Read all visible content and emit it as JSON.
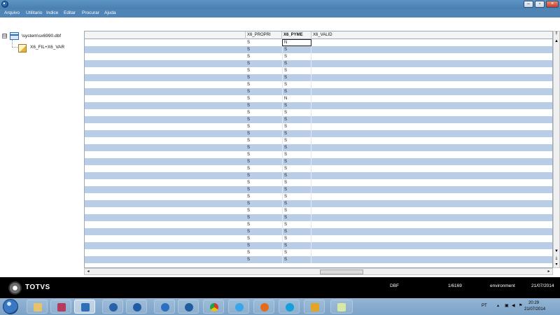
{
  "menu": {
    "items": [
      "Arquivo",
      "Utilitario",
      "Indice",
      "Editar",
      "Procurar",
      "Ajuda"
    ]
  },
  "tree": {
    "root_label": "\\system\\sx6990.dbf",
    "child_label": "X6_FIL+X6_VAR",
    "expander": "⊟"
  },
  "grid": {
    "headers": [
      "",
      "X6_PROPRI",
      "X6_PYME",
      "X6_VALID"
    ],
    "rows": [
      [
        "S",
        "N"
      ],
      [
        "S",
        "S"
      ],
      [
        "S",
        "S"
      ],
      [
        "S",
        "S"
      ],
      [
        "S",
        "S"
      ],
      [
        "S",
        "S"
      ],
      [
        "S",
        "S"
      ],
      [
        "S",
        "S"
      ],
      [
        "S",
        "N"
      ],
      [
        "S",
        "S"
      ],
      [
        "S",
        "S"
      ],
      [
        "S",
        "S"
      ],
      [
        "S",
        "S"
      ],
      [
        "S",
        "S"
      ],
      [
        "S",
        "S"
      ],
      [
        "S",
        "S"
      ],
      [
        "S",
        "S"
      ],
      [
        "S",
        "S"
      ],
      [
        "S",
        "S"
      ],
      [
        "S",
        "S"
      ],
      [
        "S",
        "S"
      ],
      [
        "S",
        "S"
      ],
      [
        "S",
        "S"
      ],
      [
        "S",
        "S"
      ],
      [
        "S",
        "S"
      ],
      [
        "S",
        "S"
      ],
      [
        "S",
        "S"
      ],
      [
        "S",
        "S"
      ],
      [
        "S",
        "S"
      ],
      [
        "S",
        "S"
      ],
      [
        "S",
        "S"
      ],
      [
        "S",
        "S"
      ]
    ]
  },
  "status": {
    "brand": "TOTVS",
    "dbtype": "DBF",
    "record": "1/6169",
    "env": "environment",
    "date": "21/07/2014"
  },
  "tray": {
    "lang": "PT",
    "time": "20:29",
    "date": "21/07/2014"
  },
  "colors": {
    "titlebar": "#5c95c5",
    "menubar": "#4f84b7",
    "row_alt": "#b9cee6",
    "statusbar": "#000000"
  }
}
